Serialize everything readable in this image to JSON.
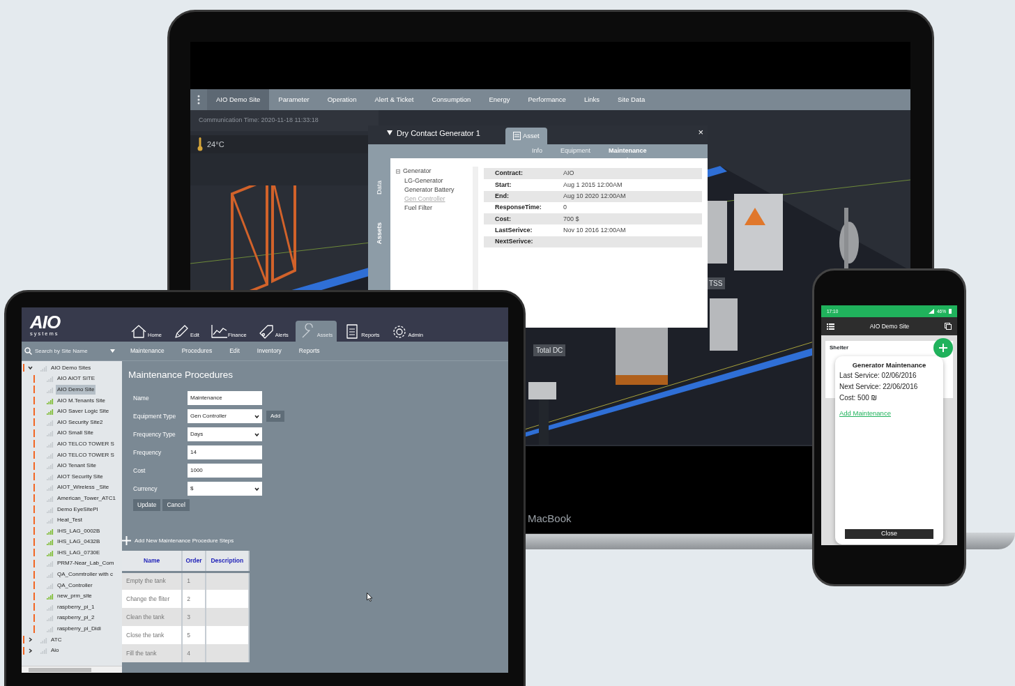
{
  "laptop": {
    "brand": "MacBook",
    "nav": [
      {
        "label": "AIO Demo Site",
        "selected": true
      },
      {
        "label": "Parameter",
        "selected": false
      },
      {
        "label": "Operation",
        "selected": false
      },
      {
        "label": "Alert & Ticket",
        "selected": false
      },
      {
        "label": "Consumption",
        "selected": false
      },
      {
        "label": "Energy",
        "selected": false
      },
      {
        "label": "Performance",
        "selected": false
      },
      {
        "label": "Links",
        "selected": false
      },
      {
        "label": "Site Data",
        "selected": false
      }
    ],
    "communication_time": "Communication Time: 2020-11-18 11:33:18",
    "temperature": "24°C",
    "scene_labels": [
      {
        "text": "TSS"
      },
      {
        "text": "Total DC"
      }
    ],
    "asset_panel": {
      "title": "Dry Contact Generator 1",
      "tab": "Asset",
      "close": "×",
      "side_tabs": [
        {
          "label": "Data",
          "selected": false
        },
        {
          "label": "Assets",
          "selected": true
        }
      ],
      "subtabs": [
        {
          "label": "Info",
          "selected": false
        },
        {
          "label": "Equipment",
          "selected": false
        },
        {
          "label": "Maintenance",
          "selected": true
        }
      ],
      "tree": {
        "label": "Generator",
        "expanded": true,
        "children": [
          {
            "label": "LG-Generator",
            "selected": false
          },
          {
            "label": "Generator Battery",
            "selected": false
          },
          {
            "label": "Gen Controller",
            "selected": true
          },
          {
            "label": "Fuel Filter",
            "selected": false
          }
        ]
      },
      "fields": [
        {
          "label": "Contract:",
          "value": "AIO"
        },
        {
          "label": "Start:",
          "value": "Aug 1 2015 12:00AM"
        },
        {
          "label": "End:",
          "value": "Aug 10 2020 12:00AM"
        },
        {
          "label": "ResponseTime:",
          "value": "0"
        },
        {
          "label": "Cost:",
          "value": "700 $"
        },
        {
          "label": "LastSerivce:",
          "value": "Nov 10 2016 12:00AM"
        },
        {
          "label": "NextSerivce:"
        }
      ]
    }
  },
  "tablet": {
    "logo": {
      "name": "AIO",
      "tagline": "systems"
    },
    "nav": [
      {
        "label": "Home",
        "selected": false
      },
      {
        "label": "Edit",
        "selected": false
      },
      {
        "label": "Finance",
        "selected": false
      },
      {
        "label": "Alerts",
        "selected": false
      },
      {
        "label": "Assets",
        "selected": true
      },
      {
        "label": "Reports",
        "selected": false
      },
      {
        "label": "Admin",
        "selected": false
      }
    ],
    "search": {
      "placeholder": "Search by Site Name"
    },
    "subnav": [
      {
        "label": "Maintenance"
      },
      {
        "label": "Procedures"
      },
      {
        "label": "Edit"
      },
      {
        "label": "Inventory"
      },
      {
        "label": "Reports"
      }
    ],
    "tree": [
      {
        "label": "AIO Demo Sites",
        "expanded": true,
        "online": false,
        "selected": false,
        "children": [
          {
            "label": "AIO AIOT SITE",
            "online": false,
            "selected": false
          },
          {
            "label": "AIO Demo Site",
            "online": false,
            "selected": true
          },
          {
            "label": "AIO M.Tenants Site",
            "online": true,
            "selected": false
          },
          {
            "label": "AIO Saver Logic Site",
            "online": true,
            "selected": false
          },
          {
            "label": "AIO Security Site2",
            "online": false,
            "selected": false
          },
          {
            "label": "AIO Small Site",
            "online": false,
            "selected": false
          },
          {
            "label": "AIO TELCO TOWER S",
            "online": false,
            "selected": false
          },
          {
            "label": "AIO TELCO TOWER S",
            "online": false,
            "selected": false
          },
          {
            "label": "AIO Tenant Site",
            "online": false,
            "selected": false
          },
          {
            "label": "AIOT Security Site",
            "online": false,
            "selected": false
          },
          {
            "label": "AIOT_Wireless _Site",
            "online": false,
            "selected": false
          },
          {
            "label": "American_Tower_ATC1",
            "online": false,
            "selected": false
          },
          {
            "label": "Demo EyeSitePI",
            "online": false,
            "selected": false
          },
          {
            "label": "Heat_Test",
            "online": false,
            "selected": false
          },
          {
            "label": "IHS_LAG_0002B",
            "online": true,
            "selected": false
          },
          {
            "label": "IHS_LAG_0432B",
            "online": true,
            "selected": false
          },
          {
            "label": "IHS_LAG_0730E",
            "online": true,
            "selected": false
          },
          {
            "label": "PRM7-Near_Lab_Com",
            "online": false,
            "selected": false
          },
          {
            "label": "QA_Conmtroller with c",
            "online": false,
            "selected": false
          },
          {
            "label": "QA_Controller",
            "online": false,
            "selected": false
          },
          {
            "label": "new_prm_site",
            "online": true,
            "selected": false
          },
          {
            "label": "raspberry_pi_1",
            "online": false,
            "selected": false
          },
          {
            "label": "raspberry_pi_2",
            "online": false,
            "selected": false
          },
          {
            "label": "raspberry_pi_Didi",
            "online": false,
            "selected": false
          }
        ]
      },
      {
        "label": "ATC",
        "expanded": false,
        "online": false,
        "selected": false
      },
      {
        "label": "Aio",
        "expanded": false,
        "online": false,
        "selected": false
      }
    ],
    "form": {
      "title": "Maintenance Procedures",
      "fields": [
        {
          "kind": "text",
          "label": "Name",
          "value": "Maintenance"
        },
        {
          "kind": "select",
          "label": "Equipment Type",
          "value": "Gen Controller",
          "action": "Add"
        },
        {
          "kind": "select",
          "label": "Frequency Type",
          "value": "Days"
        },
        {
          "kind": "text",
          "label": "Frequency",
          "value": "14"
        },
        {
          "kind": "text",
          "label": "Cost",
          "value": "1000"
        },
        {
          "kind": "select",
          "label": "Currency",
          "value": "$"
        }
      ],
      "buttons": [
        "Update",
        "Cancel"
      ]
    },
    "steps": {
      "add_label": "Add New Maintenance Procedure Steps",
      "columns": [
        "Name",
        "Order",
        "Description"
      ],
      "rows": [
        [
          "Empty the tank",
          "1",
          ""
        ],
        [
          "Change the fliter",
          "2",
          ""
        ],
        [
          "Clean the tank",
          "3",
          ""
        ],
        [
          "Close the tank",
          "5",
          ""
        ],
        [
          "Fill the tank",
          "4",
          ""
        ]
      ]
    }
  },
  "phone": {
    "status_time": "17:10",
    "battery": "46%",
    "title": "AIO Demo Site",
    "card_title": "Shelter",
    "dialog": {
      "title": "Generator Maintenance",
      "lines": [
        "Last Service: 02/06/2016",
        "Next Service: 22/06/2016",
        "Cost: 500 ₪"
      ],
      "link": "Add Maintenance",
      "close": "Close"
    }
  }
}
